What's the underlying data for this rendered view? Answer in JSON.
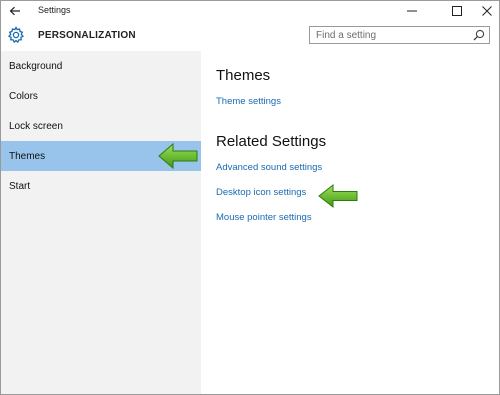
{
  "window": {
    "title": "Settings"
  },
  "header": {
    "title": "PERSONALIZATION",
    "search_placeholder": "Find a setting"
  },
  "sidebar": {
    "items": [
      {
        "label": "Background"
      },
      {
        "label": "Colors"
      },
      {
        "label": "Lock screen"
      },
      {
        "label": "Themes",
        "selected": true
      },
      {
        "label": "Start"
      }
    ]
  },
  "content": {
    "themes_heading": "Themes",
    "theme_settings_link": "Theme settings",
    "related_heading": "Related Settings",
    "links": [
      {
        "label": "Advanced sound settings"
      },
      {
        "label": "Desktop icon settings"
      },
      {
        "label": "Mouse pointer settings"
      }
    ]
  },
  "colors": {
    "accent_link": "#1a6ab3",
    "selected_item": "#98c4ec",
    "arrow_green": "#5cb82a"
  },
  "icons": [
    "back-arrow-icon",
    "minimize-icon",
    "maximize-icon",
    "close-icon",
    "gear-icon",
    "search-icon",
    "green-arrow-icon"
  ]
}
